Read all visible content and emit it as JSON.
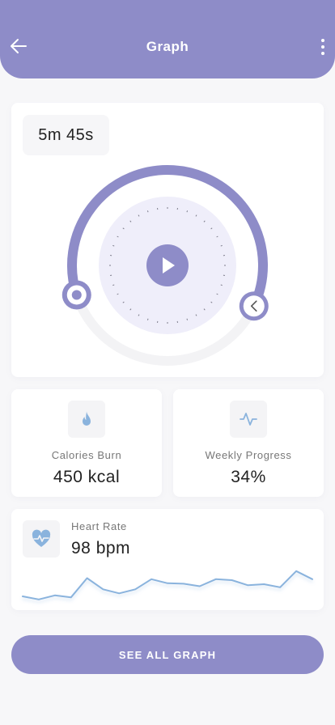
{
  "header": {
    "title": "Graph",
    "back_icon": "arrow-left-icon",
    "menu_icon": "more-vertical-icon"
  },
  "timer": {
    "elapsed": "5m 45s",
    "progress_fraction": 0.62,
    "play_icon": "play-icon",
    "prev_icon": "chevron-left-icon"
  },
  "stats": [
    {
      "icon": "flame-icon",
      "label": "Calories Burn",
      "value": "450 kcal"
    },
    {
      "icon": "activity-icon",
      "label": "Weekly Progress",
      "value": "34%"
    }
  ],
  "heart_rate": {
    "icon": "heart-pulse-icon",
    "label": "Heart Rate",
    "value": "98 bpm",
    "sparkline": [
      36,
      30,
      38,
      34,
      72,
      50,
      42,
      50,
      70,
      62,
      61,
      56,
      70,
      68,
      58,
      60,
      54,
      86,
      70
    ]
  },
  "cta": {
    "label": "SEE ALL GRAPH"
  },
  "colors": {
    "accent": "#8e8cc8",
    "accent_light": "#efeefa",
    "icon_blue": "#8ab3dd",
    "track": "#f3f3f5"
  }
}
